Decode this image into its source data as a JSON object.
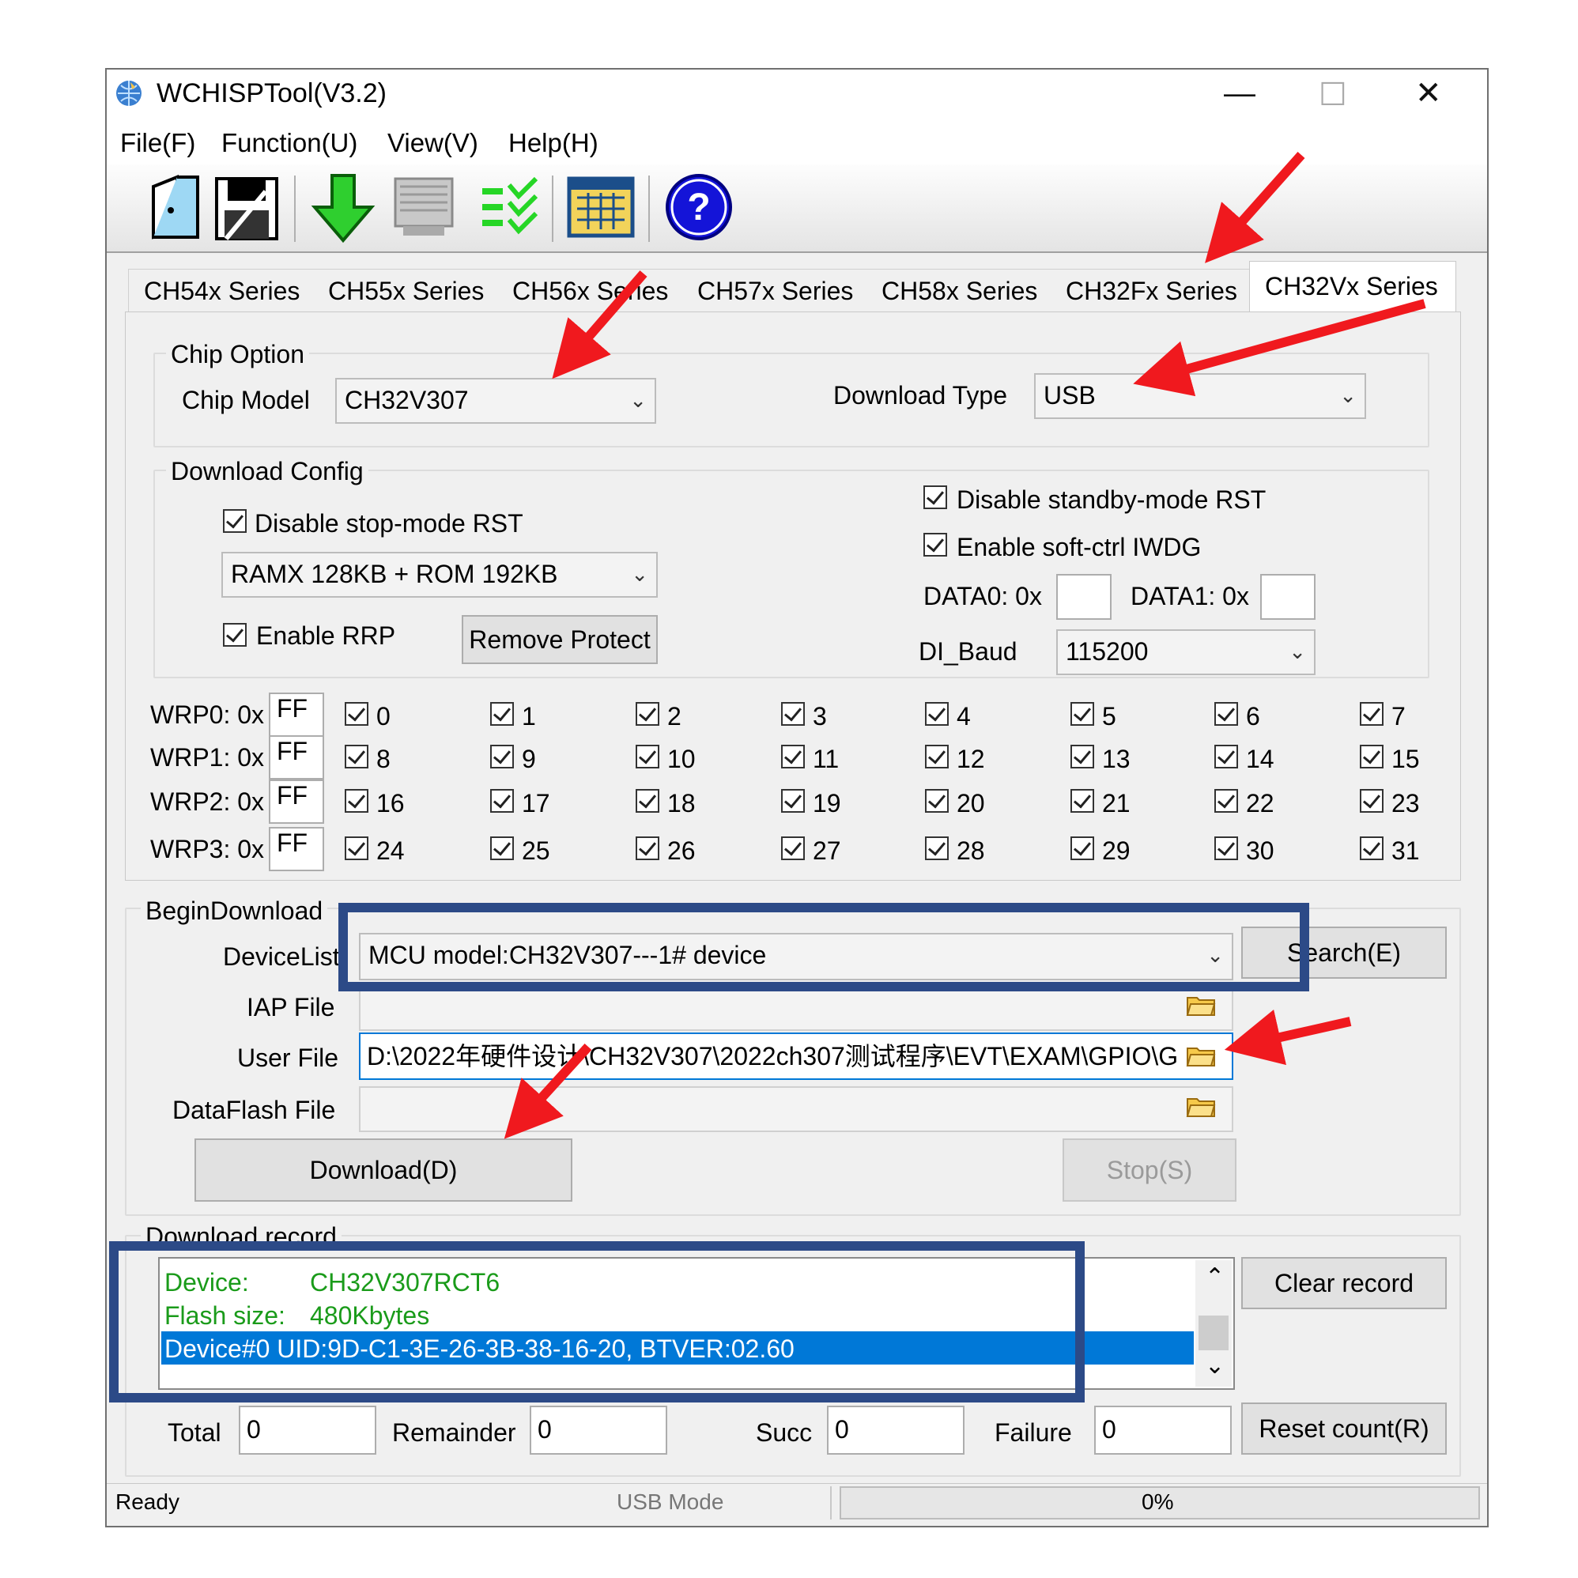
{
  "window": {
    "title": "WCHISPTool(V3.2)",
    "minimize": "—",
    "maximize": "☐",
    "close": "✕"
  },
  "menu": [
    "File(F)",
    "Function(U)",
    "View(V)",
    "Help(H)"
  ],
  "toolbar": {
    "icons": [
      "open-icon",
      "save-icon",
      "download-arrow-icon",
      "device-icon",
      "verify-icon",
      "calendar-icon",
      "help-icon"
    ],
    "help_glyph": "?"
  },
  "tabs": [
    "CH54x Series",
    "CH55x Series",
    "CH56x Series",
    "CH57x Series",
    "CH58x Series",
    "CH32Fx Series",
    "CH32Vx Series"
  ],
  "chip_option": {
    "group_label": "Chip Option",
    "model_label": "Chip Model",
    "model_value": "CH32V307",
    "download_type_label": "Download Type",
    "download_type_value": "USB"
  },
  "download_config": {
    "group_label": "Download Config",
    "disable_stop_rst": "Disable stop-mode RST",
    "memory_value": "RAMX 128KB + ROM 192KB",
    "enable_rrp": "Enable RRP",
    "remove_protect": "Remove Protect",
    "disable_standby_rst": "Disable standby-mode RST",
    "enable_iwdg": "Enable soft-ctrl IWDG",
    "data0_label": "DATA0: 0x",
    "data0_value": "",
    "data1_label": "DATA1: 0x",
    "data1_value": "",
    "dl_baud_label": "DI_Baud",
    "dl_baud_value": "115200"
  },
  "wrp": [
    {
      "label": "WRP0: 0x",
      "value": "FF",
      "bits": [
        "0",
        "1",
        "2",
        "3",
        "4",
        "5",
        "6",
        "7"
      ]
    },
    {
      "label": "WRP1: 0x",
      "value": "FF",
      "bits": [
        "8",
        "9",
        "10",
        "11",
        "12",
        "13",
        "14",
        "15"
      ]
    },
    {
      "label": "WRP2: 0x",
      "value": "FF",
      "bits": [
        "16",
        "17",
        "18",
        "19",
        "20",
        "21",
        "22",
        "23"
      ]
    },
    {
      "label": "WRP3: 0x",
      "value": "FF",
      "bits": [
        "24",
        "25",
        "26",
        "27",
        "28",
        "29",
        "30",
        "31"
      ]
    }
  ],
  "begin_download": {
    "group_label": "BeginDownload",
    "device_list_label": "DeviceList",
    "device_list_value": "MCU model:CH32V307---1# device",
    "search_button": "Search(E)",
    "iap_label": "IAP File",
    "iap_value": "",
    "user_file_label": "User File",
    "user_file_value": "D:\\2022年硬件设计\\CH32V307\\2022ch307测试程序\\EVT\\EXAM\\GPIO\\G",
    "dataflash_label": "DataFlash File",
    "dataflash_value": "",
    "download_button": "Download(D)",
    "stop_button": "Stop(S)"
  },
  "download_record": {
    "group_label": "Download record",
    "lines": [
      {
        "key": "Device:",
        "value": "CH32V307RCT6"
      },
      {
        "key": "Flash size:",
        "value": "480Kbytes"
      }
    ],
    "selected_line": "Device#0  UID:9D-C1-3E-26-3B-38-16-20, BTVER:02.60",
    "clear_button": "Clear record",
    "scroll_up": "⌃",
    "scroll_down": "⌄"
  },
  "counts": {
    "total_label": "Total",
    "total_value": "0",
    "remainder_label": "Remainder",
    "remainder_value": "0",
    "succ_label": "Succ",
    "succ_value": "0",
    "failure_label": "Failure",
    "failure_value": "0",
    "reset_button": "Reset count(R)"
  },
  "status": {
    "left": "Ready",
    "mode": "USB Mode",
    "progress_text": "0%",
    "progress": 0
  },
  "colors": {
    "accent_green": "#1a9b1a",
    "selection_blue": "#0078d7",
    "annotation_red": "#f0191e",
    "annotation_box": "#2c4a87"
  }
}
